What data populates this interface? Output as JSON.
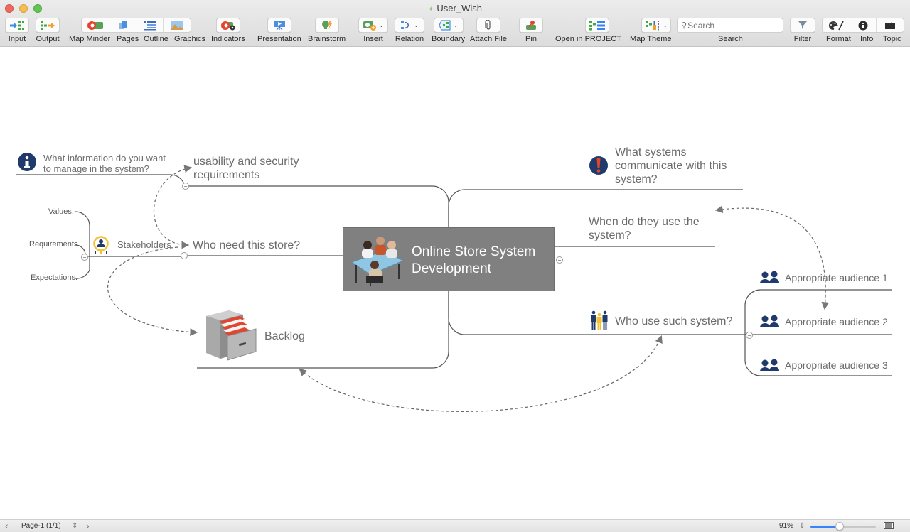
{
  "window": {
    "title": "User_Wish",
    "traffic_lights": [
      "close",
      "minimize",
      "zoom"
    ]
  },
  "toolbar": {
    "input": "Input",
    "output": "Output",
    "map_minder": "Map Minder",
    "pages": "Pages",
    "outline": "Outline",
    "graphics": "Graphics",
    "indicators": "Indicators",
    "presentation": "Presentation",
    "brainstorm": "Brainstorm",
    "insert": "Insert",
    "relation": "Relation",
    "boundary": "Boundary",
    "attach_file": "Attach File",
    "pin": "Pin",
    "open_in_project": "Open in PROJECT",
    "map_theme": "Map Theme",
    "search_label": "Search",
    "search_placeholder": "Search",
    "filter": "Filter",
    "format": "Format",
    "info": "Info",
    "topic": "Topic"
  },
  "mindmap": {
    "central": {
      "line1": "Online Store System",
      "line2": "Development",
      "icon": "meeting-table-icon",
      "fill": "#808080"
    },
    "left_branches": {
      "usability": {
        "line1": "usability and security",
        "line2": "requirements"
      },
      "info_question": {
        "line1": "What information do you want",
        "line2": "to manage in the system?",
        "icon": "info-icon"
      },
      "who_need": {
        "text": "Who need this store?"
      },
      "stakeholders": {
        "text": "Stakeholders",
        "icon": "stakeholder-icon"
      },
      "stakeholder_children": [
        "Values.",
        "Requirements",
        "Expectations."
      ],
      "backlog": {
        "text": "Backlog",
        "icon": "file-cabinet-icon"
      }
    },
    "right_branches": {
      "what_systems": {
        "line1": "What  systems",
        "line2": "communicate with this",
        "line3": "system?",
        "icon": "exclamation-icon"
      },
      "when_use": {
        "line1": "When do they use the",
        "line2": "system?"
      },
      "who_use": {
        "text": "Who use such system?",
        "icon": "people-group-icon"
      },
      "audiences": [
        "Appropriate audience 1",
        "Appropriate audience 2",
        "Appropriate audience 3"
      ]
    },
    "colors": {
      "line": "#555555",
      "relation": "#777777",
      "icon_navy": "#1f3a6b",
      "accent_red": "#e2452d",
      "accent_yellow": "#f2c12e"
    }
  },
  "statusbar": {
    "page": "Page-1 (1/1)",
    "zoom": "91%",
    "zoom_slider_fraction": 0.45
  }
}
